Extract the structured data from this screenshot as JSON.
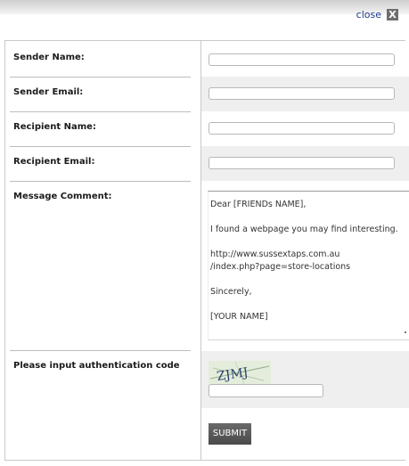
{
  "header": {
    "close_label": "close",
    "close_icon": "X"
  },
  "form": {
    "fields": [
      {
        "label": "Sender Name:",
        "value": ""
      },
      {
        "label": "Sender Email:",
        "value": ""
      },
      {
        "label": "Recipient Name:",
        "value": ""
      },
      {
        "label": "Recipient Email:",
        "value": ""
      }
    ],
    "message": {
      "label": "Message Comment:",
      "value": "Dear [FRIENDs NAME],\n\nI found a webpage you may find interesting.\n\nhttp://www.sussextaps.com.au\n/index.php?page=store-locations\n\nSincerely,\n\n[YOUR NAME]"
    },
    "captcha": {
      "label": "Please input authentication code",
      "code": "ZJMJ",
      "value": ""
    },
    "submit_label": "SUBMIT"
  },
  "colors": {
    "link": "#1f3b8a",
    "row_shade": "#efefef",
    "button": "#5a5a5a"
  }
}
